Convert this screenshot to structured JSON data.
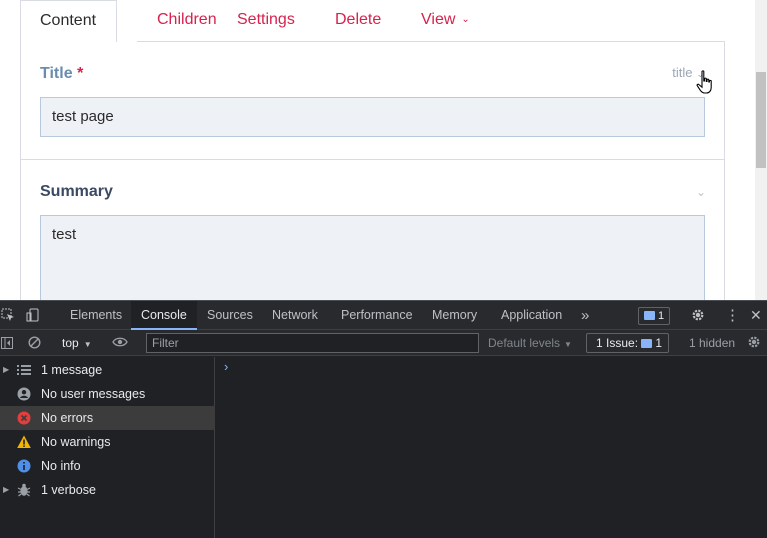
{
  "cms": {
    "tabs": [
      {
        "label": "Content",
        "active": true
      },
      {
        "label": "Children"
      },
      {
        "label": "Settings"
      },
      {
        "label": "Delete"
      },
      {
        "label": "View"
      }
    ],
    "title_field": {
      "label": "Title",
      "required_mark": "*",
      "hint": "title",
      "value": "test page"
    },
    "summary_field": {
      "label": "Summary",
      "value": "test"
    }
  },
  "devtools": {
    "tabs": [
      "Elements",
      "Console",
      "Sources",
      "Network",
      "Performance",
      "Memory",
      "Application"
    ],
    "active_tab": "Console",
    "issues_badge_count": "1",
    "context": "top",
    "filter_placeholder": "Filter",
    "levels": "Default levels",
    "issues_label": "1 Issue:",
    "issues_count": "1",
    "hidden": "1 hidden",
    "sidebar": [
      {
        "label": "1 message",
        "icon": "list-icon",
        "expandable": true
      },
      {
        "label": "No user messages",
        "icon": "user-icon"
      },
      {
        "label": "No errors",
        "icon": "error-icon",
        "selected": true
      },
      {
        "label": "No warnings",
        "icon": "warning-icon"
      },
      {
        "label": "No info",
        "icon": "info-icon"
      },
      {
        "label": "1 verbose",
        "icon": "bug-icon",
        "expandable": true
      }
    ],
    "prompt": "›",
    "colors": {
      "error": "#e33e3e",
      "warning": "#f2b600",
      "info": "#4f8fe8",
      "accent": "#8ab4f8"
    }
  }
}
